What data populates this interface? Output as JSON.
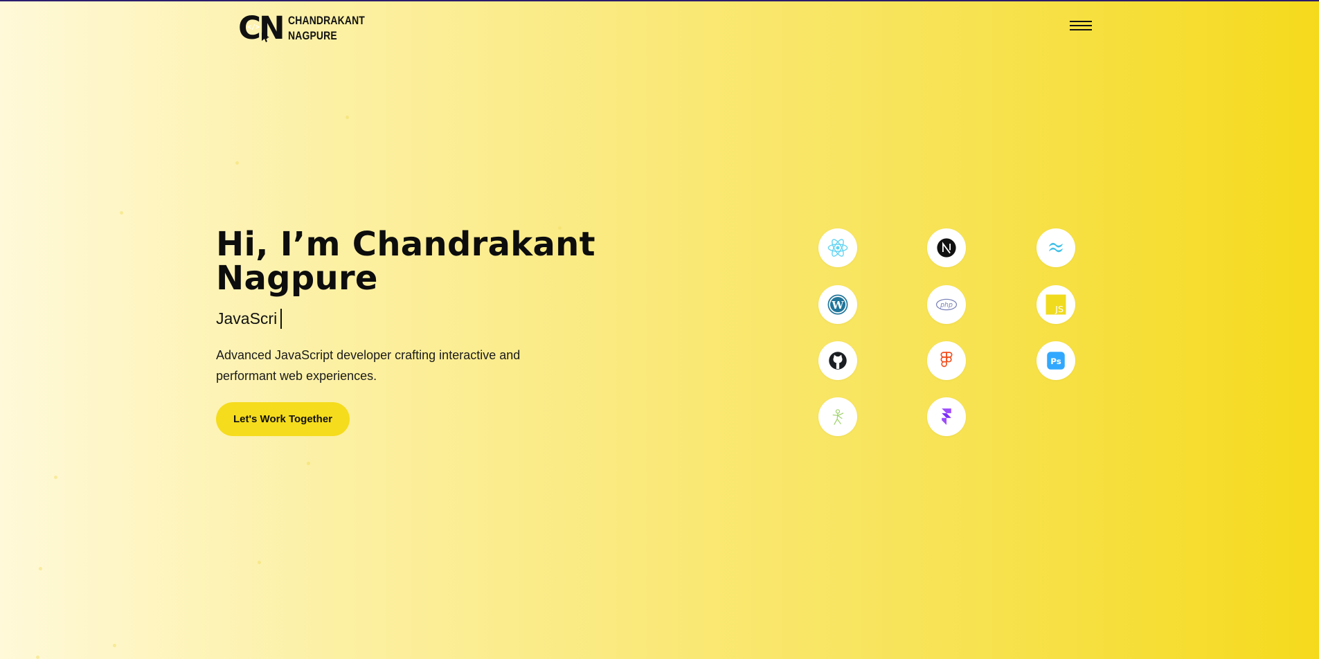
{
  "header": {
    "logo_mark": "CN",
    "logo_code": "</>",
    "logo_line1": "CHANDRAKANT",
    "logo_line2": "NAGPURE"
  },
  "hero": {
    "title_line1": "Hi, I’m Chandrakant",
    "title_line2": "Nagpure",
    "typed_text": "JavaScri",
    "description": "Advanced JavaScript developer crafting interactive and performant web experiences.",
    "cta_label": "Let's Work Together"
  },
  "tech_icons": [
    {
      "name": "react-icon",
      "color": "#5fd3f3"
    },
    {
      "name": "nextjs-icon",
      "color": "#111111"
    },
    {
      "name": "tailwind-icon",
      "color": "#3fc0e8"
    },
    {
      "name": "wordpress-icon",
      "color": "#21759b"
    },
    {
      "name": "php-icon",
      "color": "#7a82b8"
    },
    {
      "name": "javascript-icon",
      "color": "#f0db1e",
      "label": "JS"
    },
    {
      "name": "github-icon",
      "color": "#1b1f24"
    },
    {
      "name": "figma-icon",
      "color": "#f24e1e"
    },
    {
      "name": "photoshop-icon",
      "color": "#31a8ff",
      "label": "Ps"
    },
    {
      "name": "threejs-icon",
      "color": "#9bd167"
    },
    {
      "name": "framer-icon",
      "color": "#9d4dfb"
    }
  ],
  "colors": {
    "accent": "#f5dc1d",
    "top_border": "#2b1c6e",
    "text": "#0d0d0d"
  }
}
